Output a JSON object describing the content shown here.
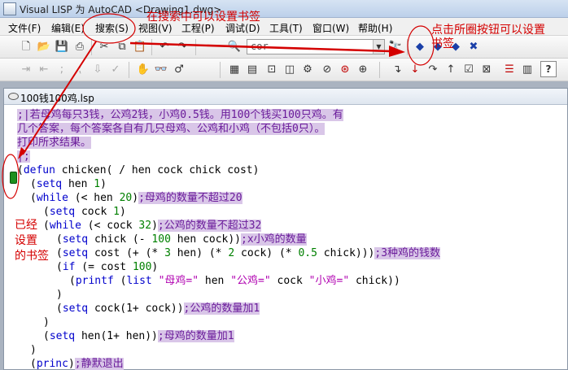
{
  "window": {
    "title": "Visual LISP 为 AutoCAD <Drawing1.dwg>"
  },
  "menu": {
    "items": [
      "文件(F)",
      "编辑(E)",
      "搜索(S)",
      "视图(V)",
      "工程(P)",
      "调试(D)",
      "工具(T)",
      "窗口(W)",
      "帮助(H)"
    ]
  },
  "toolbar": {
    "search_value": "cor"
  },
  "document": {
    "tab_title": "100钱100鸡.lsp",
    "lines": [
      {
        "indent": 0,
        "parts": [
          {
            "t": ";|若母鸡每只3钱，公鸡2钱，小鸡0.5钱。用100个钱买100只鸡。有",
            "c": "cm"
          }
        ]
      },
      {
        "indent": 0,
        "parts": [
          {
            "t": "几个答案，每个答案各自有几只母鸡、公鸡和小鸡（不包括0只）。",
            "c": "cm"
          }
        ]
      },
      {
        "indent": 0,
        "parts": [
          {
            "t": "打印所求结果。",
            "c": "cm"
          }
        ]
      },
      {
        "indent": 0,
        "parts": [
          {
            "t": "|;",
            "c": "cm"
          }
        ]
      },
      {
        "indent": 0,
        "parts": [
          {
            "t": "(",
            "c": ""
          },
          {
            "t": "defun",
            "c": "kw"
          },
          {
            "t": " chicken( / hen cock chick cost)",
            "c": ""
          }
        ]
      },
      {
        "indent": 1,
        "parts": [
          {
            "t": "(",
            "c": ""
          },
          {
            "t": "setq",
            "c": "kw"
          },
          {
            "t": " hen ",
            "c": ""
          },
          {
            "t": "1",
            "c": "num"
          },
          {
            "t": ")",
            "c": ""
          }
        ]
      },
      {
        "indent": 1,
        "parts": [
          {
            "t": "(",
            "c": ""
          },
          {
            "t": "while",
            "c": "kw"
          },
          {
            "t": " (< hen ",
            "c": ""
          },
          {
            "t": "20",
            "c": "num"
          },
          {
            "t": ")",
            "c": ""
          },
          {
            "t": ";母鸡的数量不超过20",
            "c": "cm"
          }
        ]
      },
      {
        "indent": 2,
        "parts": [
          {
            "t": "(",
            "c": ""
          },
          {
            "t": "setq",
            "c": "kw"
          },
          {
            "t": " cock ",
            "c": ""
          },
          {
            "t": "1",
            "c": "num"
          },
          {
            "t": ")",
            "c": ""
          }
        ]
      },
      {
        "indent": 2,
        "parts": [
          {
            "t": "(",
            "c": ""
          },
          {
            "t": "while",
            "c": "kw"
          },
          {
            "t": " (< cock ",
            "c": ""
          },
          {
            "t": "32",
            "c": "num"
          },
          {
            "t": ")",
            "c": ""
          },
          {
            "t": ";公鸡的数量不超过32",
            "c": "cm"
          }
        ]
      },
      {
        "indent": 3,
        "parts": [
          {
            "t": "(",
            "c": ""
          },
          {
            "t": "setq",
            "c": "kw"
          },
          {
            "t": " chick (- ",
            "c": ""
          },
          {
            "t": "100",
            "c": "num"
          },
          {
            "t": " hen cock))",
            "c": ""
          },
          {
            "t": ";x小鸡的数量",
            "c": "cm"
          }
        ]
      },
      {
        "indent": 3,
        "parts": [
          {
            "t": "(",
            "c": ""
          },
          {
            "t": "setq",
            "c": "kw"
          },
          {
            "t": " cost (+ (* ",
            "c": ""
          },
          {
            "t": "3",
            "c": "num"
          },
          {
            "t": " hen) (* ",
            "c": ""
          },
          {
            "t": "2",
            "c": "num"
          },
          {
            "t": " cock) (* ",
            "c": ""
          },
          {
            "t": "0.5",
            "c": "num"
          },
          {
            "t": " chick)))",
            "c": ""
          },
          {
            "t": ";3种鸡的钱数",
            "c": "cm"
          }
        ]
      },
      {
        "indent": 3,
        "parts": [
          {
            "t": "(",
            "c": ""
          },
          {
            "t": "if",
            "c": "kw"
          },
          {
            "t": " (= cost ",
            "c": ""
          },
          {
            "t": "100",
            "c": "num"
          },
          {
            "t": ")",
            "c": ""
          }
        ]
      },
      {
        "indent": 4,
        "parts": [
          {
            "t": "(",
            "c": ""
          },
          {
            "t": "printf",
            "c": "kw"
          },
          {
            "t": " (",
            "c": ""
          },
          {
            "t": "list",
            "c": "kw"
          },
          {
            "t": " ",
            "c": ""
          },
          {
            "t": "\"母鸡=\"",
            "c": "str"
          },
          {
            "t": " hen ",
            "c": ""
          },
          {
            "t": "\"公鸡=\"",
            "c": "str"
          },
          {
            "t": " cock ",
            "c": ""
          },
          {
            "t": "\"小鸡=\"",
            "c": "str"
          },
          {
            "t": " chick))",
            "c": ""
          }
        ]
      },
      {
        "indent": 3,
        "parts": [
          {
            "t": ")",
            "c": ""
          }
        ]
      },
      {
        "indent": 3,
        "parts": [
          {
            "t": "(",
            "c": ""
          },
          {
            "t": "setq",
            "c": "kw"
          },
          {
            "t": " cock(1+ cock))",
            "c": ""
          },
          {
            "t": ";公鸡的数量加1",
            "c": "cm"
          }
        ]
      },
      {
        "indent": 2,
        "parts": [
          {
            "t": ")",
            "c": ""
          }
        ]
      },
      {
        "indent": 2,
        "parts": [
          {
            "t": "(",
            "c": ""
          },
          {
            "t": "setq",
            "c": "kw"
          },
          {
            "t": " hen(1+ hen))",
            "c": ""
          },
          {
            "t": ";母鸡的数量加1",
            "c": "cm"
          }
        ]
      },
      {
        "indent": 1,
        "parts": [
          {
            "t": ")",
            "c": ""
          }
        ]
      },
      {
        "indent": 1,
        "parts": [
          {
            "t": "(",
            "c": ""
          },
          {
            "t": "princ",
            "c": "kw"
          },
          {
            "t": ")",
            "c": ""
          },
          {
            "t": ";静默退出",
            "c": "cm"
          }
        ]
      },
      {
        "indent": 0,
        "parts": [
          {
            "t": ")",
            "c": ""
          }
        ]
      }
    ]
  },
  "annotations": {
    "search_menu_note": "在搜索中可以设置书签",
    "button_note_line1": "点击所圈按钮可以设置",
    "button_note_line2": "书签",
    "bookmark_note_line1": "已经",
    "bookmark_note_line2": "设置",
    "bookmark_note_line3": "的书签"
  },
  "icons": {
    "toolbar1": [
      "new-file-icon",
      "open-file-icon",
      "save-icon",
      "print-icon",
      "cut-icon",
      "copy-icon",
      "paste-icon",
      "undo-icon",
      "redo-icon",
      "find-icon",
      "find-in-files-icon",
      "toggle-bookmark-icon",
      "next-bookmark-icon",
      "previous-bookmark-icon",
      "clear-bookmarks-icon"
    ],
    "toolbar2": [
      "indent-icon",
      "outdent-icon",
      "comment-icon",
      "uncomment-icon",
      "load-selection-icon",
      "check-text-icon",
      "format-icon",
      "inspect-icon",
      "watch-icon",
      "apropos-icon",
      "step-into-icon",
      "step-over-icon",
      "step-out-icon",
      "continue-icon",
      "quit-icon",
      "reset-icon",
      "toggle-breakpoint-icon",
      "last-break-icon",
      "help-icon"
    ]
  },
  "colors": {
    "annotation": "#d40000",
    "comment_bg": "#d9c6e8",
    "keyword": "#0000cc",
    "number": "#008000",
    "string": "#b000b0",
    "bookmark": "#1f8f1f"
  }
}
